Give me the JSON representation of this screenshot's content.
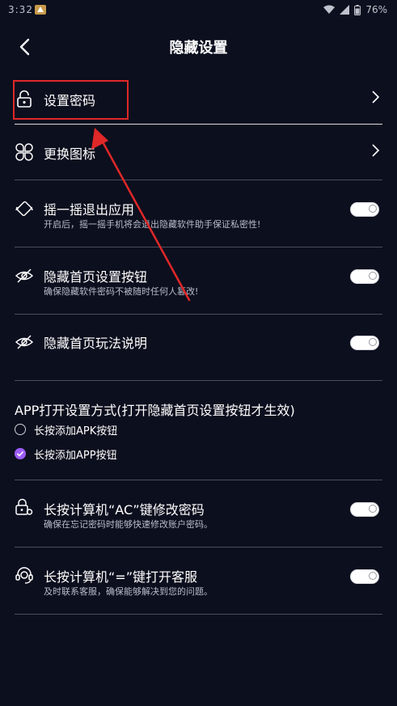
{
  "status_bar": {
    "time": "3:32",
    "battery": "76%"
  },
  "header": {
    "title": "隐藏设置"
  },
  "rows": [
    {
      "title": "设置密码",
      "icon": "lock-icon",
      "control": "chevron"
    },
    {
      "title": "更换图标",
      "icon": "grid-icon",
      "control": "chevron"
    },
    {
      "title": "摇一摇退出应用",
      "subtitle": "开启后，摇一摇手机将会退出隐藏软件助手保证私密性!",
      "icon": "shake-icon",
      "control": "toggle",
      "on": false
    },
    {
      "title": "隐藏首页设置按钮",
      "subtitle": "确保隐藏软件密码不被随时任何人篡改!",
      "icon": "eye-off-icon",
      "control": "toggle",
      "on": false
    },
    {
      "title": "隐藏首页玩法说明",
      "icon": "eye-off-icon",
      "control": "toggle",
      "on": false
    }
  ],
  "launch_section": {
    "title": "APP打开设置方式(打开隐藏首页设置按钮才生效)",
    "options": [
      {
        "label": "长按添加APK按钮",
        "selected": false
      },
      {
        "label": "长按添加APP按钮",
        "selected": true
      }
    ]
  },
  "extra_rows": [
    {
      "title": "长按计算机“AC”键修改密码",
      "subtitle": "确保在忘记密码时能够快速修改账户密码。",
      "icon": "lock-gear-icon",
      "control": "toggle",
      "on": false
    },
    {
      "title": "长按计算机“=”键打开客服",
      "subtitle": "及时联系客服，确保能够解决到您的问题。",
      "icon": "headset-icon",
      "control": "toggle",
      "on": false
    }
  ],
  "colors": {
    "background": "#0c0f1e",
    "accent": "#9b5cf6",
    "annotation": "#e02828"
  }
}
